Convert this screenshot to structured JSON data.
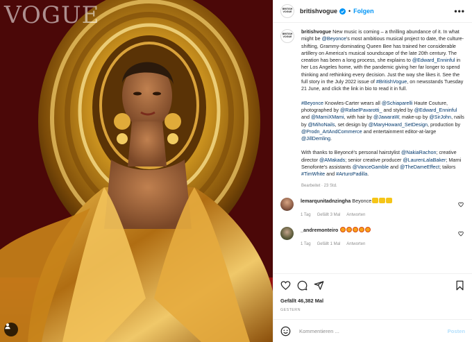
{
  "photo": {
    "wordmark": "VOGUE",
    "alt": "",
    "user_tag_icon": "person-tag-icon"
  },
  "header": {
    "avatar_text": "BRITISH VOGUE",
    "username": "britishvogue",
    "separator": "•",
    "follow_label": "Folgen",
    "more_label": "•••"
  },
  "caption": {
    "username": "britishvogue",
    "paragraphs": [
      [
        {
          "t": "New music is coming – a thrilling abundance of it. In what might be "
        },
        {
          "t": "@Beyonce",
          "link": true
        },
        {
          "t": "'s most ambitious musical project to date, the culture-shifting, Grammy-dominating Queen Bee has trained her considerable artillery on America's musical soundscape of the late 20th century. The creation has been a long process, she explains to "
        },
        {
          "t": "@Edward_Enninful",
          "link": true
        },
        {
          "t": " in her Los Angeles home, with the pandemic giving her far longer to spend thinking and rethinking every decision. Just the way she likes it. See the full story in the July 2022 issue of "
        },
        {
          "t": "#BritishVogue",
          "link": true
        },
        {
          "t": ", on newsstands Tuesday 21 June, and click the link in bio to read it in full."
        }
      ],
      [
        {
          "t": "#Beyonce",
          "link": true
        },
        {
          "t": " Knowles-Carter wears all "
        },
        {
          "t": "@Schiaparelli",
          "link": true
        },
        {
          "t": " Haute Couture, photographed by "
        },
        {
          "t": "@RafaelPavarotti_",
          "link": true
        },
        {
          "t": " and styled by "
        },
        {
          "t": "@Edward_Enninful",
          "link": true
        },
        {
          "t": " and "
        },
        {
          "t": "@MarniXMami",
          "link": true
        },
        {
          "t": ", with hair by "
        },
        {
          "t": "@JawaraW",
          "link": true
        },
        {
          "t": ", make-up by "
        },
        {
          "t": "@SirJohn",
          "link": true
        },
        {
          "t": ", nails by "
        },
        {
          "t": "@MihoNails",
          "link": true
        },
        {
          "t": ", set design by "
        },
        {
          "t": "@MaryHoward_SetDesign",
          "link": true
        },
        {
          "t": ", production by "
        },
        {
          "t": "@Prodn_ArtAndCommerce",
          "link": true
        },
        {
          "t": " and entertainment editor-at-large "
        },
        {
          "t": "@JillDemling",
          "link": true
        },
        {
          "t": "."
        }
      ],
      [
        {
          "t": "With thanks to Beyoncé's personal hairstylist "
        },
        {
          "t": "@NakiaRachon",
          "link": true
        },
        {
          "t": "; creative director "
        },
        {
          "t": "@AMakads",
          "link": true
        },
        {
          "t": "; senior creative producer "
        },
        {
          "t": "@LaurenLalaBaker",
          "link": true
        },
        {
          "t": "; Marni Senofonte's assistants "
        },
        {
          "t": "@VanceGamble",
          "link": true
        },
        {
          "t": " and "
        },
        {
          "t": "@TheDameEffect",
          "link": true
        },
        {
          "t": "; tailors "
        },
        {
          "t": "#TimWhite",
          "link": true
        },
        {
          "t": " and "
        },
        {
          "t": "#ArturoPadilla",
          "link": true
        },
        {
          "t": "."
        }
      ]
    ],
    "edited": "Bearbeitet · 23 Std."
  },
  "comments": [
    {
      "username": "lemarqunitadnzingha",
      "text": "Beyonce",
      "emoji_count": 3,
      "emoji_style": "yellow",
      "time": "1 Tag",
      "likes": "Gefällt 3 Mal",
      "reply": "Antworten"
    },
    {
      "username": "_andremonteiro",
      "text": "",
      "emoji_count": 5,
      "emoji_style": "face",
      "time": "1 Tag",
      "likes": "Gefällt 1 Mal",
      "reply": "Antworten"
    }
  ],
  "actions": {
    "icons": [
      "heart-icon",
      "comment-icon",
      "share-icon",
      "save-icon"
    ],
    "likes": "Gefällt 46,382 Mal",
    "date": "GESTERN"
  },
  "comment_bar": {
    "placeholder": "Kommentieren ...",
    "post_label": "Posten"
  },
  "colors": {
    "link": "#00376b",
    "follow": "#0095f6",
    "post_disabled": "#b2dffc",
    "muted": "#8e8e8e",
    "verified": "#0095f6"
  }
}
